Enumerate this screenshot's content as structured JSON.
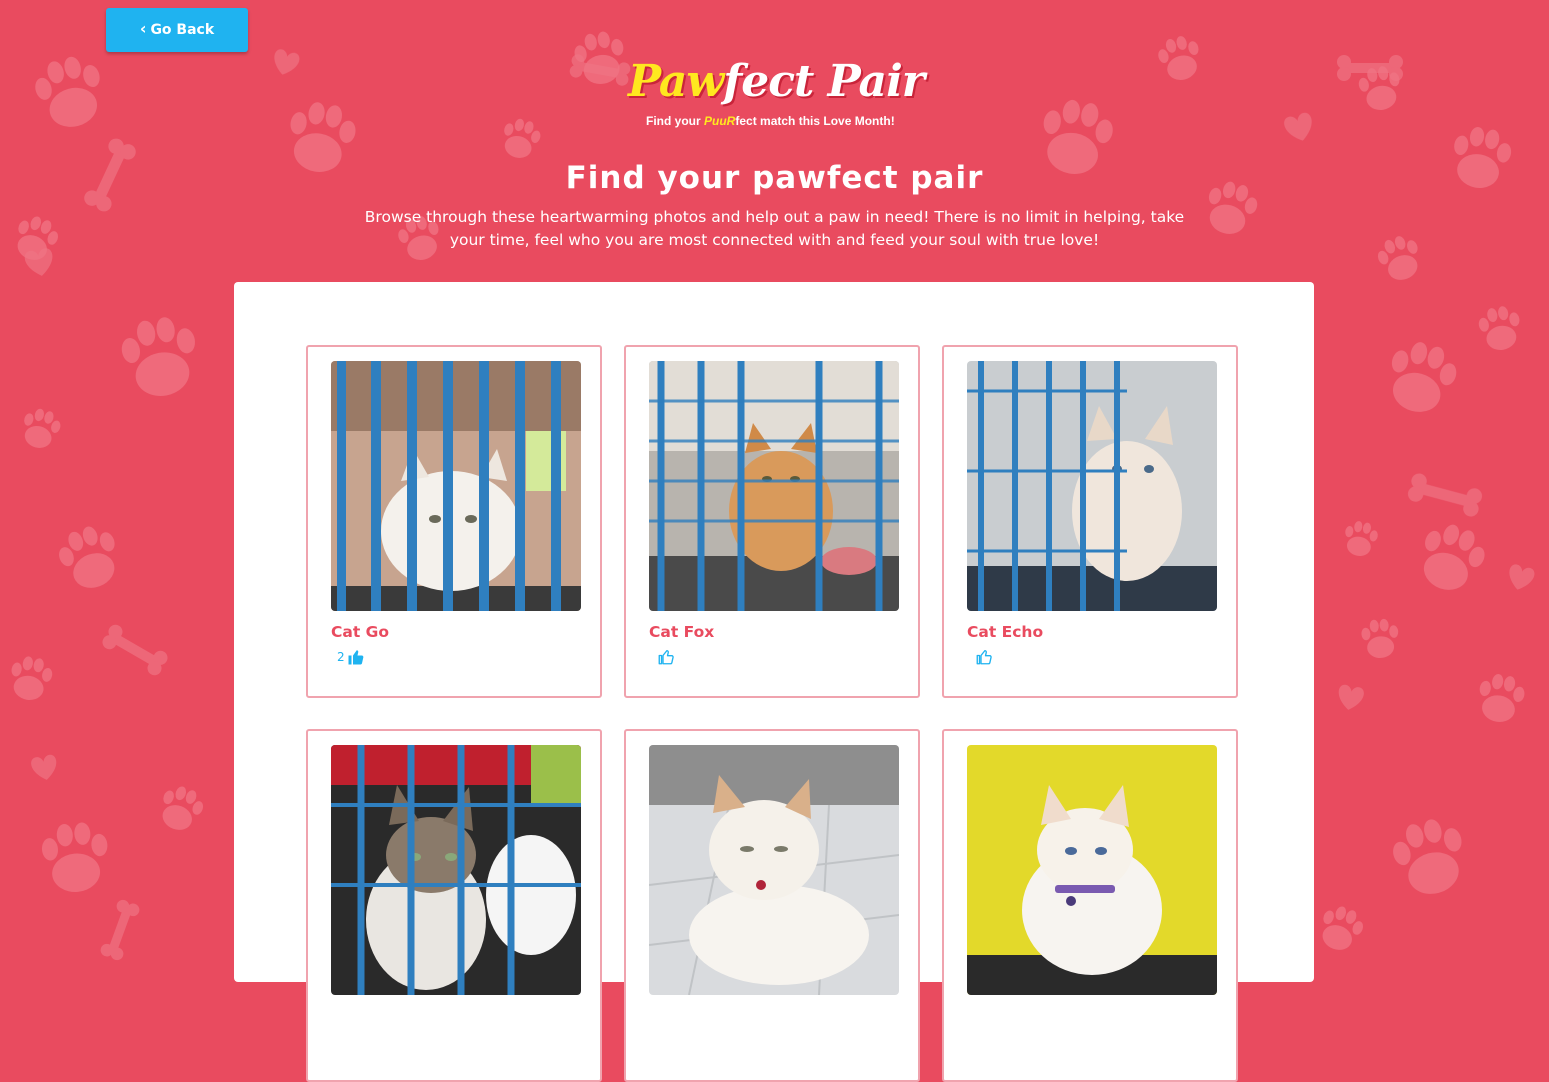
{
  "colors": {
    "background": "#e94b5f",
    "accent": "#1fb3f0",
    "name": "#e94b5f",
    "card_border": "#f0a3ae",
    "logo_yellow": "#ffe81f"
  },
  "nav": {
    "back_label": "Go Back",
    "back_icon": "chevron-left-icon"
  },
  "logo": {
    "paw": "Paw",
    "rest": "fect Pair",
    "tag_pre": "Find your ",
    "tag_purr": "PuuR",
    "tag_post": "fect match this Love Month!"
  },
  "hero": {
    "title": "Find your pawfect pair",
    "subtitle": "Browse through these heartwarming photos and help out a paw in need! There is no limit in helping, take your time, feel who you are most connected with and feed your soul with true love!"
  },
  "cats": [
    {
      "name": "Cat Go",
      "likes": "2",
      "liked": true,
      "icon": "thumbs-up-icon"
    },
    {
      "name": "Cat Fox",
      "likes": "",
      "liked": false,
      "icon": "thumbs-up-outline-icon"
    },
    {
      "name": "Cat Echo",
      "likes": "",
      "liked": false,
      "icon": "thumbs-up-outline-icon"
    },
    {
      "name": "",
      "likes": "",
      "liked": false
    },
    {
      "name": "",
      "likes": "",
      "liked": false
    },
    {
      "name": "",
      "likes": "",
      "liked": false
    }
  ]
}
